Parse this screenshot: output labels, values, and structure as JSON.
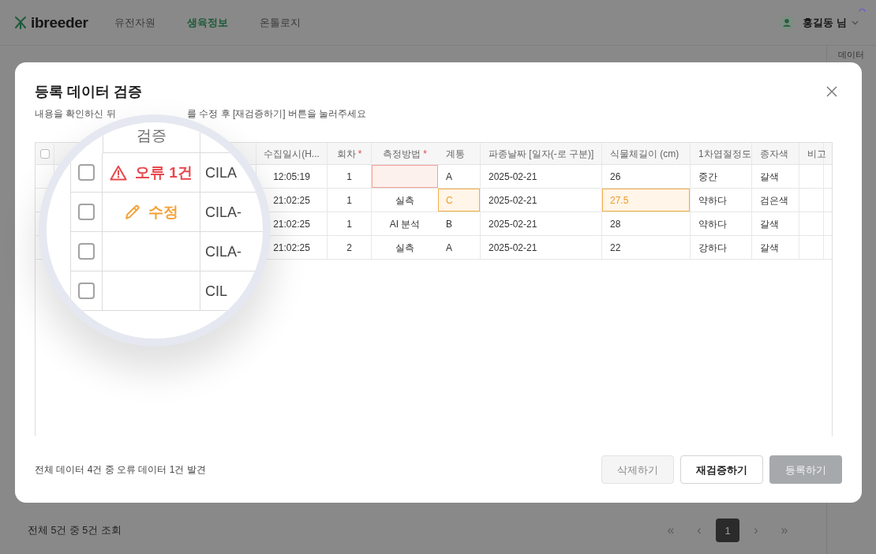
{
  "navbar": {
    "brand": "ibreeder",
    "items": [
      {
        "label": "유전자원",
        "selected": false
      },
      {
        "label": "생육정보",
        "selected": true
      },
      {
        "label": "온톨로지",
        "selected": false
      }
    ],
    "user": "홍길동 님"
  },
  "side_panel": {
    "title": "데이터"
  },
  "list_footer": {
    "summary": "전체 5건 중 5건 조회",
    "pagination": {
      "first": "«",
      "prev": "‹",
      "pages": [
        {
          "label": "1",
          "selected": true
        }
      ],
      "next": "›",
      "last": "»"
    }
  },
  "dialog": {
    "title": "등록 데이터 검증",
    "subtitle_parts": [
      "내용을 확인하신 뒤",
      "를 수정 후 [재검증하기] 버튼을 눌러주세요"
    ],
    "table": {
      "select_all_checked": false,
      "validation_header": "검증",
      "fixed_columns": [
        {
          "label": "수집일시(H..."
        },
        {
          "label": "회차",
          "required_mark": "*"
        },
        {
          "label": "측정방법",
          "required_mark": "*"
        }
      ],
      "scroll_columns": [
        {
          "label": "계통"
        },
        {
          "label": "파종날짜 [일자(-로 구분)]"
        },
        {
          "label": "식물체길이 (cm)"
        },
        {
          "label": "1차엽절정도"
        },
        {
          "label": "종자색"
        },
        {
          "label": "비고"
        }
      ],
      "rows": [
        {
          "checked": false,
          "validation": {
            "kind": "error",
            "label": "오류 1건"
          },
          "id": "CILA",
          "fixed_cells": [
            {
              "kind": "plain",
              "value": "12:05:19"
            },
            {
              "kind": "plain",
              "value": "1"
            },
            {
              "kind": "error"
            }
          ],
          "scroll_cells": [
            {
              "kind": "plain",
              "value": "A"
            },
            {
              "kind": "plain",
              "value": "2025-02-21"
            },
            {
              "kind": "plain",
              "value": "26"
            },
            {
              "kind": "plain",
              "value": "중간"
            },
            {
              "kind": "plain",
              "value": "갈색"
            }
          ]
        },
        {
          "checked": false,
          "validation": {
            "kind": "edited",
            "label": "수정"
          },
          "id": "CILA-",
          "fixed_cells": [
            {
              "kind": "plain",
              "value": "21:02:25"
            },
            {
              "kind": "plain",
              "value": "1"
            },
            {
              "kind": "plain",
              "value": "실측"
            }
          ],
          "scroll_cells": [
            {
              "kind": "edited",
              "value": "C"
            },
            {
              "kind": "plain",
              "value": "2025-02-21"
            },
            {
              "kind": "edited",
              "value": "27.5"
            },
            {
              "kind": "plain",
              "value": "약하다"
            },
            {
              "kind": "plain",
              "value": "검은색"
            }
          ]
        },
        {
          "checked": false,
          "id": "CILA-",
          "fixed_cells": [
            {
              "kind": "plain",
              "value": "21:02:25"
            },
            {
              "kind": "plain",
              "value": "1"
            },
            {
              "kind": "plain",
              "value": "AI 분석"
            }
          ],
          "scroll_cells": [
            {
              "kind": "plain",
              "value": "B"
            },
            {
              "kind": "plain",
              "value": "2025-02-21"
            },
            {
              "kind": "plain",
              "value": "28"
            },
            {
              "kind": "plain",
              "value": "약하다"
            },
            {
              "kind": "plain",
              "value": "갈색"
            }
          ]
        },
        {
          "checked": false,
          "id": "CIL",
          "fixed_cells": [
            {
              "kind": "plain",
              "value": "21:02:25"
            },
            {
              "kind": "plain",
              "value": "2"
            },
            {
              "kind": "plain",
              "value": "실측"
            }
          ],
          "scroll_cells": [
            {
              "kind": "plain",
              "value": "A"
            },
            {
              "kind": "plain",
              "value": "2025-02-21"
            },
            {
              "kind": "plain",
              "value": "22"
            },
            {
              "kind": "plain",
              "value": "강하다"
            },
            {
              "kind": "plain",
              "value": "갈색"
            }
          ]
        }
      ]
    },
    "summary": "전체 데이터 4건 중 오류 데이터 1건 발견",
    "buttons": [
      {
        "label": "삭제하기",
        "kind": "light",
        "disabled": true
      },
      {
        "label": "재검증하기",
        "kind": "outline",
        "disabled": false
      },
      {
        "label": "등록하기",
        "kind": "primary",
        "disabled": true
      }
    ]
  }
}
